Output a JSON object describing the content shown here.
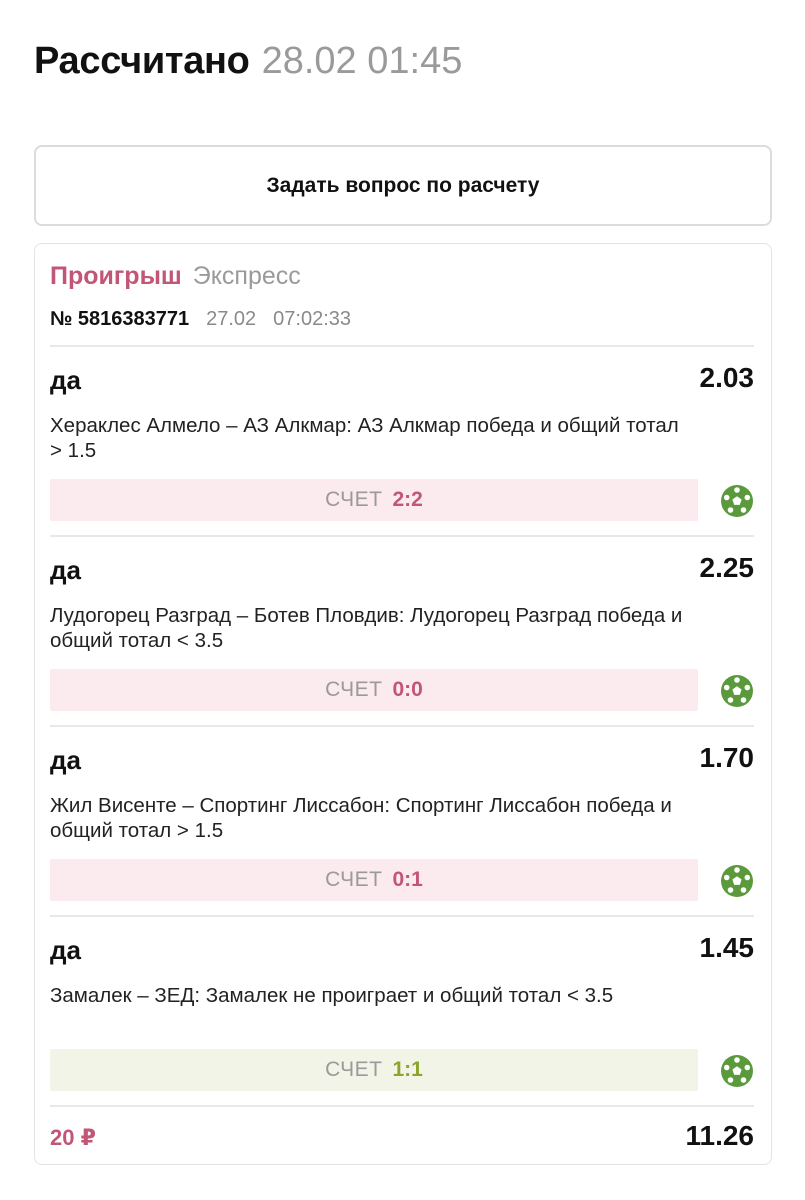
{
  "header": {
    "status": "Рассчитано",
    "datetime": "28.02 01:45"
  },
  "ask_button": {
    "label": "Задать вопрос по расчету"
  },
  "bet": {
    "result": "Проигрыш",
    "type": "Экспресс",
    "number": "№ 5816383771",
    "date": "27.02",
    "time": "07:02:33",
    "events": [
      {
        "pick": "да",
        "odd": "2.03",
        "description": "Хераклес Алмело – АЗ Алкмар: АЗ Алкмар победа и общий тотал > 1.5",
        "score_label": "СЧЕТ",
        "score": "2:2",
        "outcome": "lose",
        "icon": "soccer-ball-icon"
      },
      {
        "pick": "да",
        "odd": "2.25",
        "description": "Лудогорец Разград – Ботев Пловдив: Лудогорец Разград победа и общий тотал < 3.5",
        "score_label": "СЧЕТ",
        "score": "0:0",
        "outcome": "lose",
        "icon": "soccer-ball-icon"
      },
      {
        "pick": "да",
        "odd": "1.70",
        "description": "Жил Висенте – Спортинг Лиссабон: Спортинг Лиссабон победа и общий тотал > 1.5",
        "score_label": "СЧЕТ",
        "score": "0:1",
        "outcome": "lose",
        "icon": "soccer-ball-icon"
      },
      {
        "pick": "да",
        "odd": "1.45",
        "description": "Замалек – ЗЕД: Замалек не проиграет и общий тотал < 3.5",
        "score_label": "СЧЕТ",
        "score": "1:1",
        "outcome": "win",
        "icon": "soccer-ball-icon"
      }
    ],
    "stake": "20 ₽",
    "total_odd": "11.26"
  },
  "colors": {
    "lose_accent": "#c25677",
    "lose_bg": "#fbeaee",
    "win_accent": "#8aa52a",
    "win_bg": "#f1f4e6",
    "ball_green": "#5a9a3c"
  }
}
